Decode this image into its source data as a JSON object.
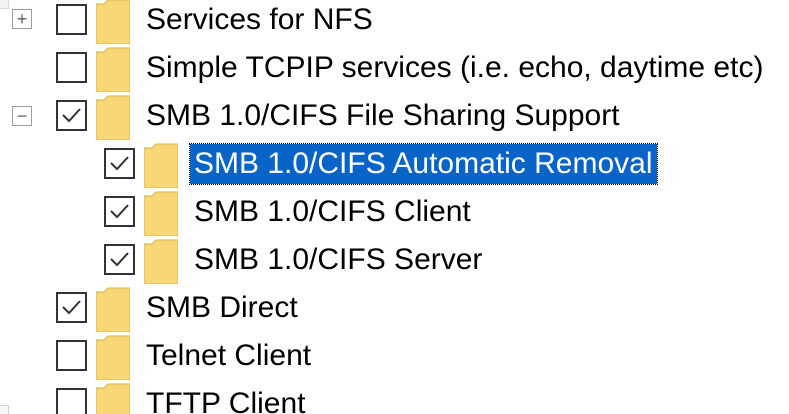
{
  "window": {
    "title": ""
  },
  "tree": {
    "items": [
      {
        "label": "Services for NFS",
        "checked": false,
        "expandable": true,
        "expanded": false,
        "expander_symbol": "+",
        "icon": "folder-icon"
      },
      {
        "label": "Simple TCPIP services (i.e. echo, daytime etc)",
        "checked": false,
        "expandable": false,
        "icon": "folder-icon"
      },
      {
        "label": "SMB 1.0/CIFS File Sharing Support",
        "checked": true,
        "expandable": true,
        "expanded": true,
        "expander_symbol": "−",
        "icon": "folder-icon"
      },
      {
        "label": "SMB 1.0/CIFS Automatic Removal",
        "checked": true,
        "expandable": false,
        "selected": true,
        "icon": "folder-icon"
      },
      {
        "label": "SMB 1.0/CIFS Client",
        "checked": true,
        "expandable": false,
        "icon": "folder-icon"
      },
      {
        "label": "SMB 1.0/CIFS Server",
        "checked": true,
        "expandable": false,
        "icon": "folder-icon"
      },
      {
        "label": "SMB Direct",
        "checked": true,
        "expandable": false,
        "icon": "folder-icon"
      },
      {
        "label": "Telnet Client",
        "checked": false,
        "expandable": false,
        "icon": "folder-icon"
      },
      {
        "label": "TFTP Client",
        "checked": false,
        "expandable": false,
        "icon": "folder-icon"
      }
    ]
  },
  "colors": {
    "selection": "#0a64c8",
    "folder_fill": "#f8d775",
    "folder_edge": "#e0b24c",
    "checkbox_border": "#333333",
    "checkmark": "#333333",
    "expander_border": "#9d9d9d"
  }
}
